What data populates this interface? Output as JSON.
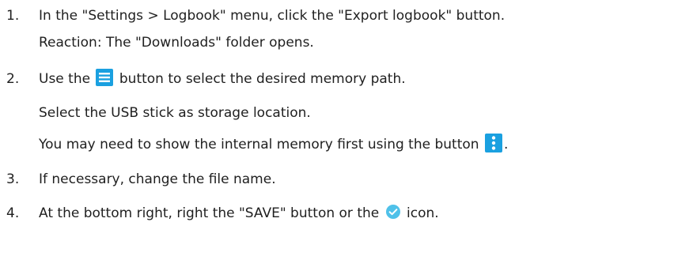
{
  "steps": [
    {
      "number": "1.",
      "text": "In the \"Settings > Logbook\" menu, click the \"Export logbook\" button.",
      "reaction": "Reaction: The \"Downloads\" folder opens."
    },
    {
      "number": "2.",
      "text_before_icon": "Use the",
      "icon": "menu-icon",
      "text_after_icon": "button to select the desired memory path.",
      "line2": "Select the USB stick as storage location.",
      "line3_before_icon": "You may need to show the internal memory first using the button",
      "line3_icon": "more-vertical-icon",
      "line3_after_icon": "."
    },
    {
      "number": "3.",
      "text": "If necessary, change the file name."
    },
    {
      "number": "4.",
      "text_before_icon": "At the bottom right, right the \"SAVE\" button or the",
      "icon": "check-circle-icon",
      "text_after_icon": "icon."
    }
  ],
  "colors": {
    "text": "#1f1f1f",
    "icon_blue": "#1aa0e0",
    "check_circle": "#4fc1e9"
  }
}
